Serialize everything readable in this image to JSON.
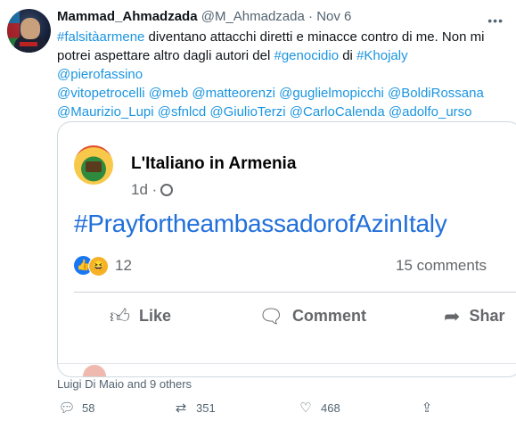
{
  "tweet": {
    "author_name": "Mammad_Ahmadzada",
    "author_handle": "@M_Ahmadzada",
    "separator": "·",
    "date": "Nov 6",
    "more_icon": "more-horizontal-icon",
    "text_parts": {
      "hashtag1": "#falsitàarmene",
      "text1": " diventano attacchi diretti e minacce contro di me. Non mi potrei aspettare altro dagli autori del ",
      "hashtag2": "#genocidio",
      "text2": " di ",
      "hashtag3": "#Khojaly",
      "mention1": "@pierofassino",
      "mentions_line": "@vitopetrocelli @meb @matteorenzi @guglielmopicchi @BoldiRossana @Maurizio_Lupi @sfnlcd @GiulioTerzi @CarloCalenda @adolfo_urso"
    },
    "liked_by": "Luigi Di Maio and 9 others",
    "stats": {
      "replies": "58",
      "retweets": "351",
      "likes": "468"
    }
  },
  "embedded_card": {
    "page_name": "L'Italiano in Armenia",
    "post_age": "1d ·",
    "post_hashtag": "#PrayfortheambassadorofAzinItaly",
    "reaction_count": "12",
    "comments_count": "15 comments",
    "actions": {
      "like": "Like",
      "comment": "Comment",
      "share": "Shar"
    }
  },
  "colors": {
    "link": "#1b95e0",
    "fb_link": "#216fdb",
    "muted": "#536471"
  }
}
